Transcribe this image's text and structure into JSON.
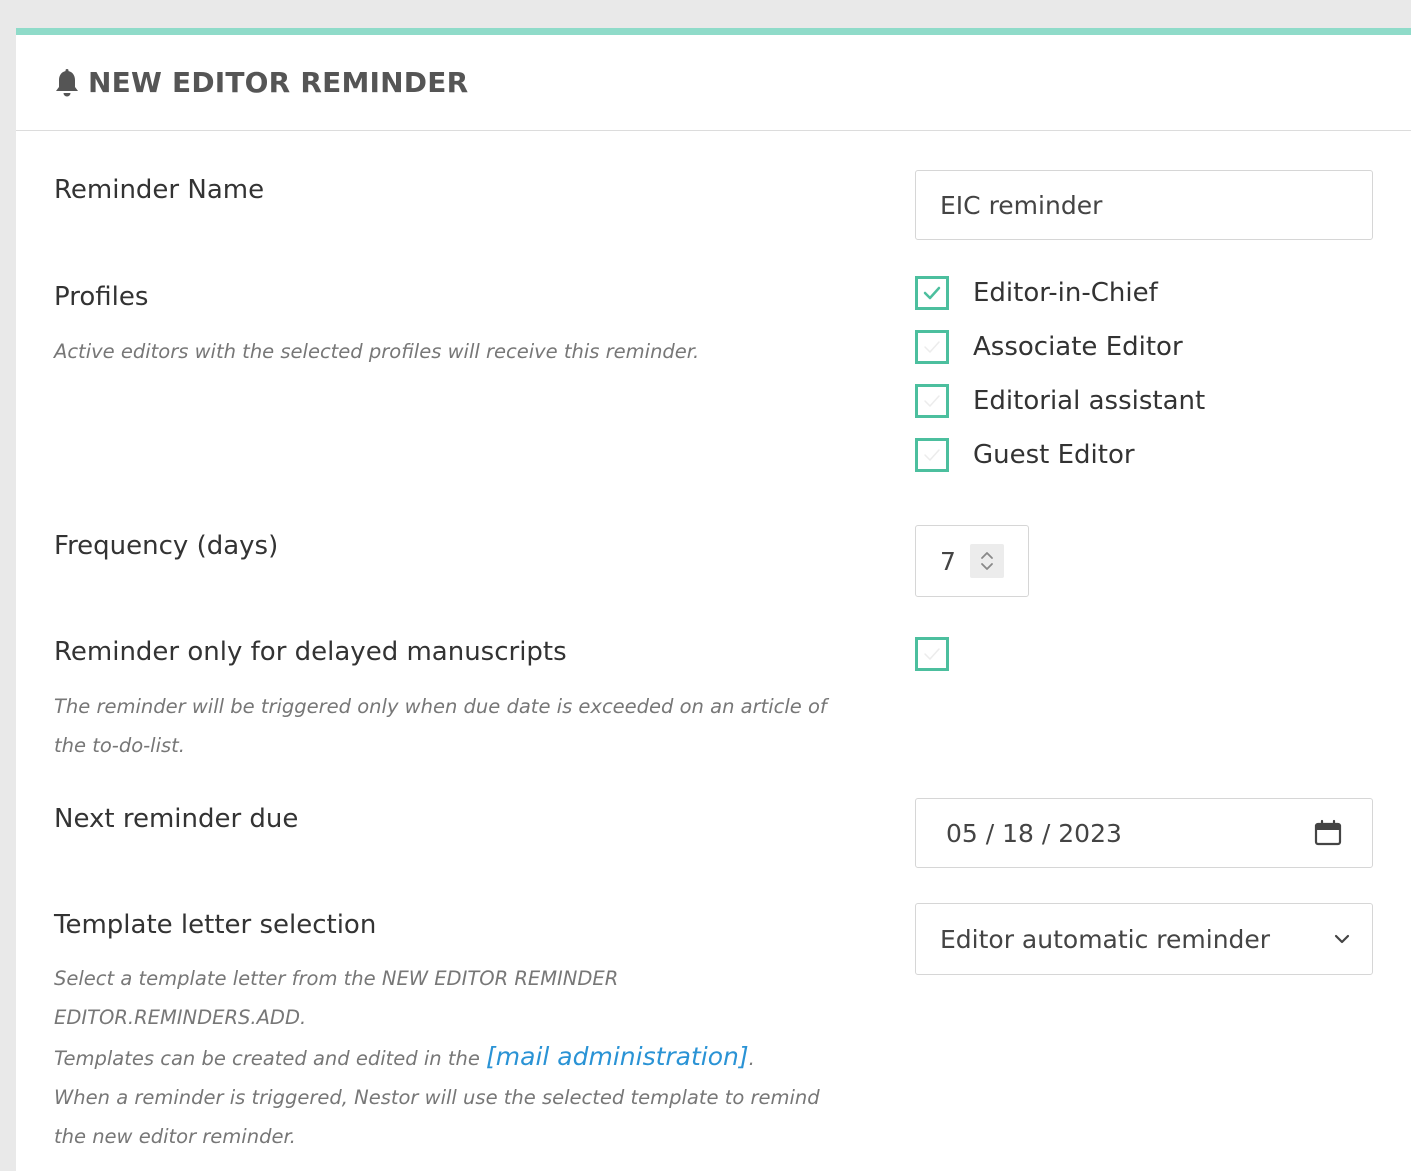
{
  "header": {
    "title": "NEW EDITOR REMINDER",
    "icon": "bell-icon"
  },
  "colors": {
    "accent": "#8fdbc9",
    "checkbox": "#4cbf9e",
    "link": "#2a93d5"
  },
  "reminder_name": {
    "label": "Reminder Name",
    "value": "EIC reminder"
  },
  "profiles": {
    "label": "Profiles",
    "help": "Active editors with the selected profiles will receive this reminder.",
    "options": [
      {
        "label": "Editor-in-Chief",
        "checked": true
      },
      {
        "label": "Associate Editor",
        "checked": false
      },
      {
        "label": "Editorial assistant",
        "checked": false
      },
      {
        "label": "Guest Editor",
        "checked": false
      }
    ]
  },
  "frequency": {
    "label": "Frequency (days)",
    "value": "7"
  },
  "delayed": {
    "label": "Reminder only for delayed manuscripts",
    "help_line1": "The reminder will be triggered only when due date is exceeded on an article of",
    "help_line2": "the to-do-list.",
    "checked": false
  },
  "next_due": {
    "label": "Next reminder due",
    "value": "05 / 18 / 2023",
    "icon": "calendar-icon"
  },
  "template": {
    "label": "Template letter selection",
    "selected": "Editor automatic reminder",
    "help_line1": "Select a template letter from the NEW EDITOR REMINDER",
    "help_line2": "EDITOR.REMINDERS.ADD.",
    "help_line3_prefix": "Templates can be created and edited in the ",
    "help_link": "[mail administration]",
    "help_line3_suffix": ".",
    "help_line4": "When a reminder is triggered, Nestor will use the selected template to remind",
    "help_line5": "the new editor reminder."
  }
}
